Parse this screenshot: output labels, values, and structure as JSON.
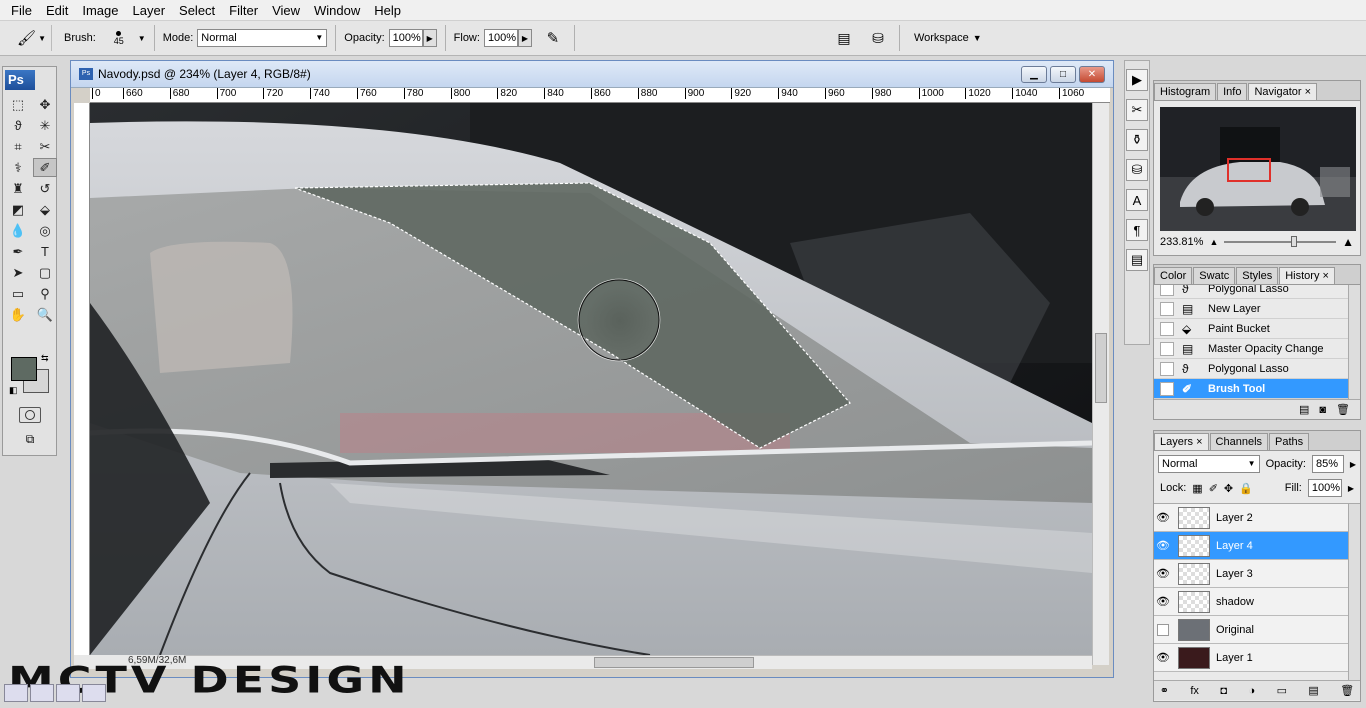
{
  "menu": [
    "File",
    "Edit",
    "Image",
    "Layer",
    "Select",
    "Filter",
    "View",
    "Window",
    "Help"
  ],
  "options": {
    "brush_label": "Brush:",
    "brush_size": "45",
    "mode_label": "Mode:",
    "mode_value": "Normal",
    "opacity_label": "Opacity:",
    "opacity_value": "100%",
    "flow_label": "Flow:",
    "flow_value": "100%",
    "workspace_label": "Workspace"
  },
  "toolbox": {
    "logo": "Ps",
    "foreground_color": "#5e6a62",
    "background_color": "#d6d6d6"
  },
  "document": {
    "title": "Navody.psd @ 234% (Layer 4, RGB/8#)",
    "ruler_ticks": [
      "0",
      "660",
      "680",
      "700",
      "720",
      "740",
      "760",
      "780",
      "800",
      "820",
      "840",
      "860",
      "880",
      "900",
      "920",
      "940",
      "960",
      "980",
      "1000",
      "1020",
      "1040",
      "1060"
    ],
    "status": "6,59M/32,6M"
  },
  "watermark": "MCTV DESIGN",
  "navigator": {
    "tabs": [
      "Histogram",
      "Info",
      "Navigator"
    ],
    "zoom": "233.81%"
  },
  "history": {
    "tabs": [
      "Color",
      "Swatc",
      "Styles",
      "History"
    ],
    "items": [
      {
        "label": "Polygonal Lasso",
        "icon": "lasso-icon"
      },
      {
        "label": "New Layer",
        "icon": "new-layer-icon"
      },
      {
        "label": "Paint Bucket",
        "icon": "paint-bucket-icon"
      },
      {
        "label": "Master Opacity Change",
        "icon": "opacity-icon"
      },
      {
        "label": "Polygonal Lasso",
        "icon": "lasso-icon"
      },
      {
        "label": "Brush Tool",
        "icon": "brush-icon"
      }
    ]
  },
  "layers": {
    "tabs": [
      "Layers",
      "Channels",
      "Paths"
    ],
    "blend_mode": "Normal",
    "opacity_label": "Opacity:",
    "opacity_value": "85%",
    "lock_label": "Lock:",
    "fill_label": "Fill:",
    "fill_value": "100%",
    "items": [
      {
        "name": "Layer 2",
        "visible": true
      },
      {
        "name": "Layer 4",
        "visible": true,
        "selected": true
      },
      {
        "name": "Layer 3",
        "visible": true
      },
      {
        "name": "shadow",
        "visible": true
      },
      {
        "name": "Original",
        "visible": false
      },
      {
        "name": "Layer 1",
        "visible": true
      }
    ]
  },
  "colors": {
    "selection_blue": "#3399ff",
    "glass_tint": "#5e6a62"
  }
}
